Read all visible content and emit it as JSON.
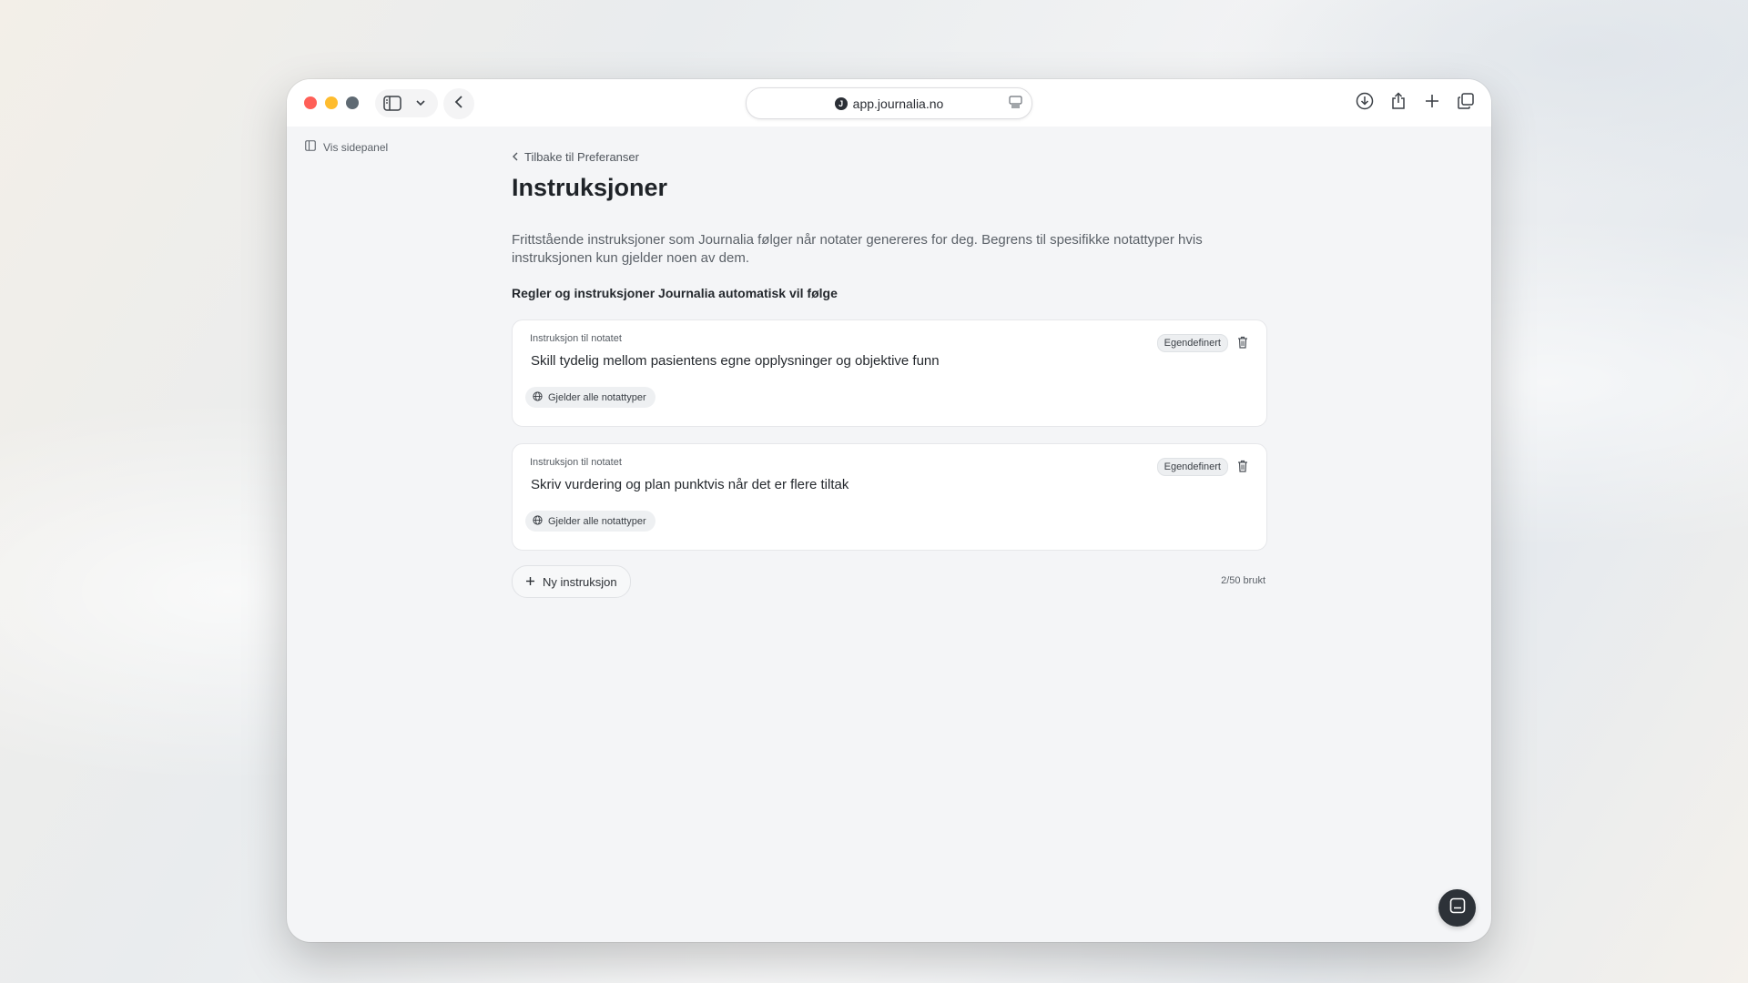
{
  "browser": {
    "url": "app.journalia.no",
    "colors": {
      "close": "#ff5f57",
      "minimize": "#febc2e",
      "maximize": "#5f6a73"
    },
    "icons": [
      "sidebar-icon",
      "chevron-down-icon",
      "back-chevron-icon",
      "site-favicon",
      "reader-mode-icon",
      "download-icon",
      "share-icon",
      "plus-icon",
      "tabs-overview-icon"
    ]
  },
  "sidebar": {
    "toggle_label": "Vis sidepanel"
  },
  "page": {
    "back_link": "Tilbake til Preferanser",
    "title": "Instruksjoner",
    "description": "Frittstående instruksjoner som Journalia følger når notater genereres for deg. Begrens til spesifikke notattyper hvis instruksjonen kun gjelder noen av dem.",
    "section_heading": "Regler og instruksjoner Journalia automatisk vil følge"
  },
  "instructions": [
    {
      "label": "Instruksjon til notatet",
      "text": "Skill tydelig mellom pasientens egne opplysninger og objektive funn",
      "badge": "Egendefinert",
      "scope": "Gjelder alle notattyper"
    },
    {
      "label": "Instruksjon til notatet",
      "text": "Skriv vurdering og plan punktvis når det er flere tiltak",
      "badge": "Egendefinert",
      "scope": "Gjelder alle notattyper"
    }
  ],
  "footer": {
    "new_button": "Ny instruksjon",
    "usage": "2/50 brukt"
  }
}
